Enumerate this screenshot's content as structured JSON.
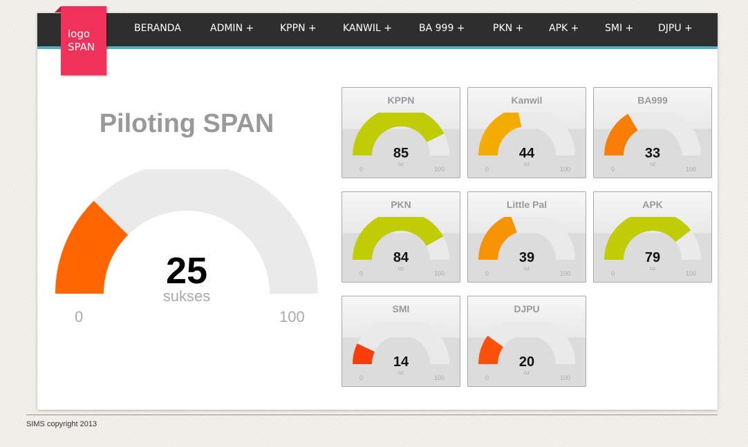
{
  "nav": {
    "items": [
      {
        "label": "BERANDA"
      },
      {
        "label": "ADMIN +"
      },
      {
        "label": "KPPN +"
      },
      {
        "label": "KANWIL +"
      },
      {
        "label": "BA 999 +"
      },
      {
        "label": "PKN +"
      },
      {
        "label": "APK +"
      },
      {
        "label": "SMI +"
      },
      {
        "label": "DJPU +"
      }
    ]
  },
  "logo": {
    "line1": "logo",
    "line2": "SPAN"
  },
  "main": {
    "title": "Piloting SPAN",
    "gauge": {
      "value": 25,
      "value_text": "25",
      "unit": "sukses",
      "min": "0",
      "max": "100",
      "color": "#ff6600"
    }
  },
  "gauges": [
    {
      "title": "KPPN",
      "value": 85,
      "value_text": "85",
      "unit": "oz",
      "min": "0",
      "max": "100",
      "color": "#c0cc04"
    },
    {
      "title": "Kanwil",
      "value": 44,
      "value_text": "44",
      "unit": "oz",
      "min": "0",
      "max": "100",
      "color": "#f4ac03"
    },
    {
      "title": "BA999",
      "value": 33,
      "value_text": "33",
      "unit": "oz",
      "min": "0",
      "max": "100",
      "color": "#f77f07"
    },
    {
      "title": "PKN",
      "value": 84,
      "value_text": "84",
      "unit": "oz",
      "min": "0",
      "max": "100",
      "color": "#c0cc04"
    },
    {
      "title": "Little Pal",
      "value": 39,
      "value_text": "39",
      "unit": "oz",
      "min": "0",
      "max": "100",
      "color": "#f69406"
    },
    {
      "title": "APK",
      "value": 79,
      "value_text": "79",
      "unit": "oz",
      "min": "0",
      "max": "100",
      "color": "#c0cc04"
    },
    {
      "title": "SMI",
      "value": 14,
      "value_text": "14",
      "unit": "oz",
      "min": "0",
      "max": "100",
      "color": "#fa3d0a"
    },
    {
      "title": "DJPU",
      "value": 20,
      "value_text": "20",
      "unit": "oz",
      "min": "0",
      "max": "100",
      "color": "#fa500a"
    }
  ],
  "footer": {
    "text": "SIMS copyright 2013"
  }
}
